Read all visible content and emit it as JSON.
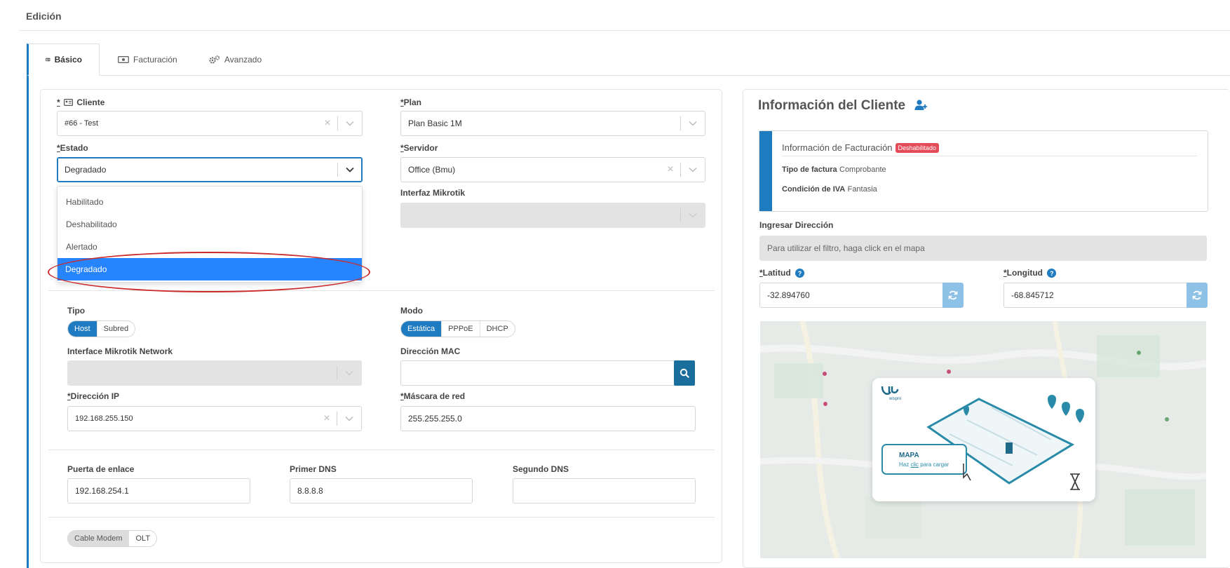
{
  "page": {
    "title": "Edición"
  },
  "tabs": [
    {
      "label": "Básico",
      "icon": "id-card-icon",
      "active": true
    },
    {
      "label": "Facturación",
      "icon": "money-bill-icon",
      "active": false
    },
    {
      "label": "Avanzado",
      "icon": "cogs-icon",
      "active": false
    }
  ],
  "form": {
    "cliente": {
      "required_mark": "*",
      "label": "Cliente",
      "value": "#66 - Test"
    },
    "plan": {
      "required_mark": "*",
      "label": "Plan",
      "value": "Plan Basic 1M"
    },
    "estado": {
      "required_mark": "*",
      "label": "Estado",
      "value": "Degradado",
      "options": [
        "Habilitado",
        "Deshabilitado",
        "Alertado",
        "Degradado"
      ],
      "selected_index": 3
    },
    "servidor": {
      "required_mark": "*",
      "label": "Servidor",
      "value": "Office (Bmu)"
    },
    "interfaz_mikrotik": {
      "label": "Interfaz Mikrotik",
      "value": ""
    },
    "tipo": {
      "label": "Tipo",
      "options": [
        "Host",
        "Subred"
      ],
      "selected": "Host"
    },
    "modo": {
      "label": "Modo",
      "options": [
        "Estática",
        "PPPoE",
        "DHCP"
      ],
      "selected": "Estática"
    },
    "interface_network": {
      "label": "Interface Mikrotik Network",
      "value": ""
    },
    "mac": {
      "label": "Dirección MAC",
      "value": ""
    },
    "ip": {
      "required_mark": "*",
      "label": "Dirección IP",
      "value": "192.168.255.150"
    },
    "mascara": {
      "required_mark": "*",
      "label": "Máscara de red",
      "value": "255.255.255.0"
    },
    "gateway": {
      "label": "Puerta de enlace",
      "value": "192.168.254.1"
    },
    "dns1": {
      "label": "Primer DNS",
      "value": "8.8.8.8"
    },
    "dns2": {
      "label": "Segundo DNS",
      "value": ""
    },
    "equipo": {
      "options": [
        "Cable Modem",
        "OLT"
      ],
      "selected": "Cable Modem"
    }
  },
  "client_info": {
    "title": "Información del Cliente",
    "billing": {
      "title": "Información de Facturación",
      "badge": "Deshabilitado",
      "tipo_label": "Tipo de factura",
      "tipo_value": "Comprobante",
      "iva_label": "Condición de IVA",
      "iva_value": "Fantasia"
    },
    "direccion_label": "Ingresar Dirección",
    "direccion_placeholder": "Para utilizar el filtro, haga click en el mapa",
    "latitud": {
      "required_mark": "*",
      "label": "Latitud",
      "value": "-32.894760"
    },
    "longitud": {
      "required_mark": "*",
      "label": "Longitud",
      "value": "-68.845712"
    },
    "map": {
      "brand": "wispro",
      "title": "MAPA",
      "subtitle_pre": "Haz ",
      "subtitle_link": "clic",
      "subtitle_post": " para cargar"
    }
  },
  "colors": {
    "accent": "#1f7bc1",
    "selected": "#2684ff",
    "danger": "#e24b57",
    "highlight": "#cc2b2b"
  }
}
